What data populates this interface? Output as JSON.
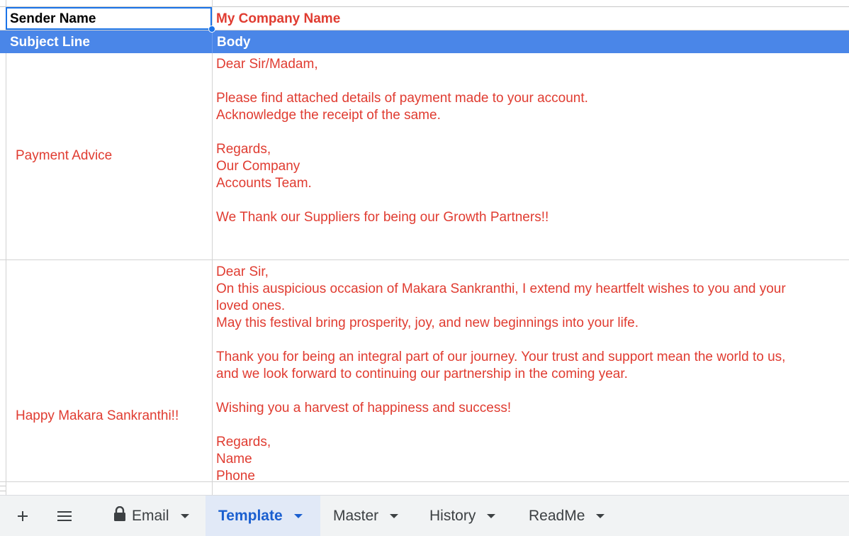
{
  "sheet": {
    "header_row": {
      "label": "Sender Name",
      "value": "My Company Name",
      "label_color": "#000000",
      "value_color": "#e03c31"
    },
    "columns_row": {
      "col1": "Subject Line",
      "col2": "Body",
      "background": "#4a86e8"
    },
    "rows": [
      {
        "subject": "Payment Advice",
        "body": [
          "Dear Sir/Madam,",
          "",
          "Please find attached details of payment made to your account.",
          "Acknowledge the receipt of the same.",
          "",
          "Regards,",
          "Our Company",
          "Accounts Team.",
          "",
          "We Thank our Suppliers for being our Growth Partners!!"
        ]
      },
      {
        "subject": "Happy Makara Sankranthi!!",
        "body": [
          "Dear Sir,",
          "On this auspicious occasion of Makara Sankranthi, I extend my heartfelt wishes to you and your",
          "loved ones.",
          "May this festival bring prosperity, joy, and new beginnings into your life.",
          "",
          "Thank you for being an integral part of our journey. Your trust and support mean the world to us,",
          "and we look forward to continuing our partnership in the coming year.",
          "",
          "Wishing you a harvest of happiness and success!",
          "",
          "Regards,",
          "Name",
          "Phone"
        ]
      }
    ]
  },
  "tabbar": {
    "add_icon": "plus-icon",
    "menu_icon": "list-icon",
    "tabs": [
      {
        "label": "Email",
        "locked": true,
        "active": false
      },
      {
        "label": "Template",
        "locked": false,
        "active": true
      },
      {
        "label": "Master",
        "locked": false,
        "active": false
      },
      {
        "label": "History",
        "locked": false,
        "active": false
      },
      {
        "label": "ReadMe",
        "locked": false,
        "active": false
      }
    ],
    "active_color": "#1a5fd0"
  }
}
